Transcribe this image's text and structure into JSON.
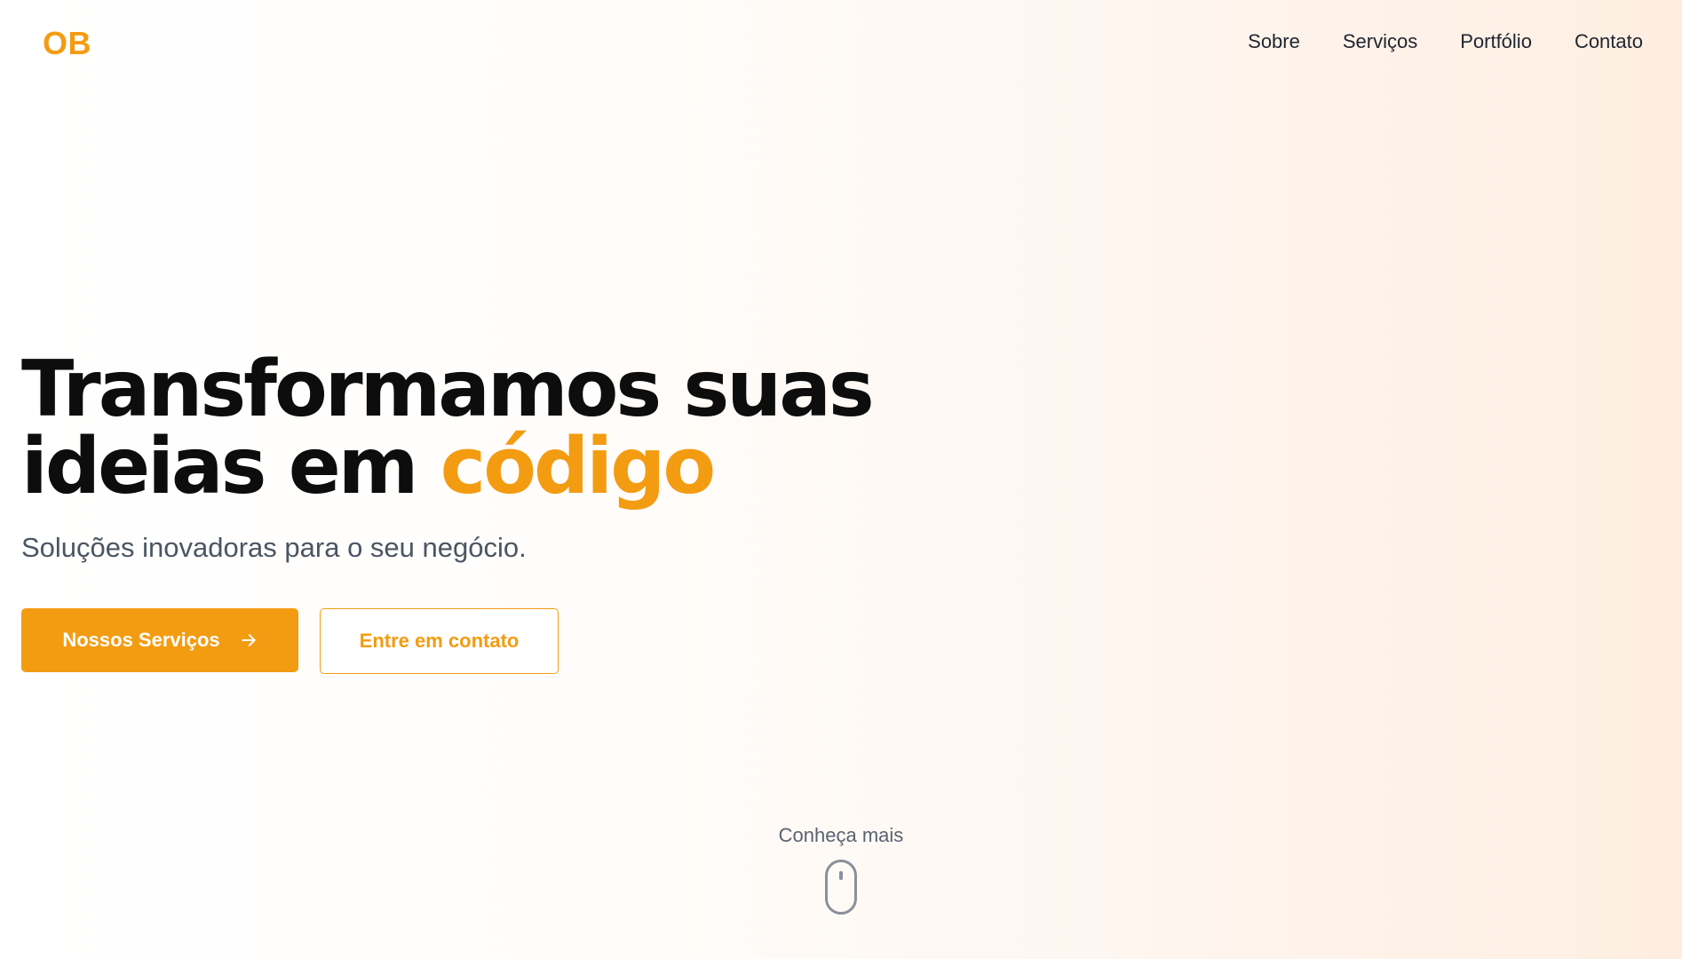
{
  "brand": {
    "logo_text": "OB",
    "accent_color": "#f39c12"
  },
  "nav": {
    "items": [
      {
        "label": "Sobre"
      },
      {
        "label": "Serviços"
      },
      {
        "label": "Portfólio"
      },
      {
        "label": "Contato"
      }
    ]
  },
  "hero": {
    "title_line1": "Transformamos suas",
    "title_line2_prefix": "ideias em ",
    "title_line2_accent": "código",
    "subtitle": "Soluções inovadoras para o seu negócio.",
    "primary_cta": {
      "label": "Nossos Serviços",
      "icon": "arrow-right-icon"
    },
    "secondary_cta": {
      "label": "Entre em contato"
    }
  },
  "scroll_cue": {
    "label": "Conheça mais",
    "icon": "mouse-icon"
  }
}
